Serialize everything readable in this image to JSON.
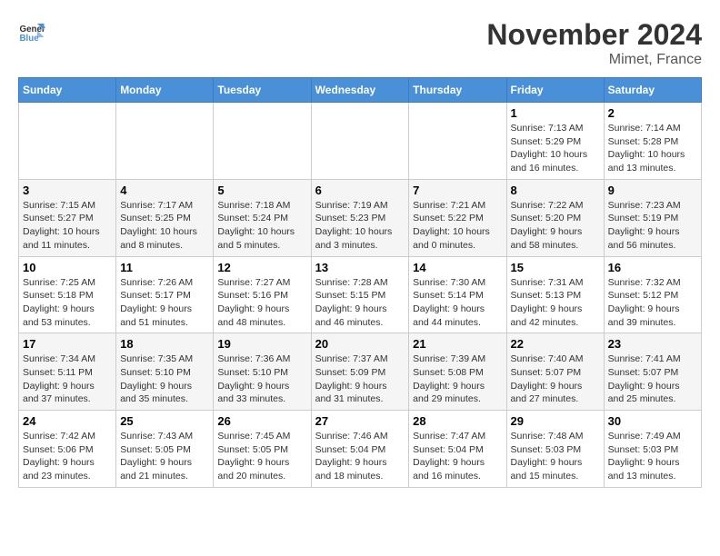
{
  "logo": {
    "line1": "General",
    "line2": "Blue"
  },
  "title": "November 2024",
  "location": "Mimet, France",
  "days_of_week": [
    "Sunday",
    "Monday",
    "Tuesday",
    "Wednesday",
    "Thursday",
    "Friday",
    "Saturday"
  ],
  "weeks": [
    [
      {
        "num": "",
        "info": ""
      },
      {
        "num": "",
        "info": ""
      },
      {
        "num": "",
        "info": ""
      },
      {
        "num": "",
        "info": ""
      },
      {
        "num": "",
        "info": ""
      },
      {
        "num": "1",
        "info": "Sunrise: 7:13 AM\nSunset: 5:29 PM\nDaylight: 10 hours and 16 minutes."
      },
      {
        "num": "2",
        "info": "Sunrise: 7:14 AM\nSunset: 5:28 PM\nDaylight: 10 hours and 13 minutes."
      }
    ],
    [
      {
        "num": "3",
        "info": "Sunrise: 7:15 AM\nSunset: 5:27 PM\nDaylight: 10 hours and 11 minutes."
      },
      {
        "num": "4",
        "info": "Sunrise: 7:17 AM\nSunset: 5:25 PM\nDaylight: 10 hours and 8 minutes."
      },
      {
        "num": "5",
        "info": "Sunrise: 7:18 AM\nSunset: 5:24 PM\nDaylight: 10 hours and 5 minutes."
      },
      {
        "num": "6",
        "info": "Sunrise: 7:19 AM\nSunset: 5:23 PM\nDaylight: 10 hours and 3 minutes."
      },
      {
        "num": "7",
        "info": "Sunrise: 7:21 AM\nSunset: 5:22 PM\nDaylight: 10 hours and 0 minutes."
      },
      {
        "num": "8",
        "info": "Sunrise: 7:22 AM\nSunset: 5:20 PM\nDaylight: 9 hours and 58 minutes."
      },
      {
        "num": "9",
        "info": "Sunrise: 7:23 AM\nSunset: 5:19 PM\nDaylight: 9 hours and 56 minutes."
      }
    ],
    [
      {
        "num": "10",
        "info": "Sunrise: 7:25 AM\nSunset: 5:18 PM\nDaylight: 9 hours and 53 minutes."
      },
      {
        "num": "11",
        "info": "Sunrise: 7:26 AM\nSunset: 5:17 PM\nDaylight: 9 hours and 51 minutes."
      },
      {
        "num": "12",
        "info": "Sunrise: 7:27 AM\nSunset: 5:16 PM\nDaylight: 9 hours and 48 minutes."
      },
      {
        "num": "13",
        "info": "Sunrise: 7:28 AM\nSunset: 5:15 PM\nDaylight: 9 hours and 46 minutes."
      },
      {
        "num": "14",
        "info": "Sunrise: 7:30 AM\nSunset: 5:14 PM\nDaylight: 9 hours and 44 minutes."
      },
      {
        "num": "15",
        "info": "Sunrise: 7:31 AM\nSunset: 5:13 PM\nDaylight: 9 hours and 42 minutes."
      },
      {
        "num": "16",
        "info": "Sunrise: 7:32 AM\nSunset: 5:12 PM\nDaylight: 9 hours and 39 minutes."
      }
    ],
    [
      {
        "num": "17",
        "info": "Sunrise: 7:34 AM\nSunset: 5:11 PM\nDaylight: 9 hours and 37 minutes."
      },
      {
        "num": "18",
        "info": "Sunrise: 7:35 AM\nSunset: 5:10 PM\nDaylight: 9 hours and 35 minutes."
      },
      {
        "num": "19",
        "info": "Sunrise: 7:36 AM\nSunset: 5:10 PM\nDaylight: 9 hours and 33 minutes."
      },
      {
        "num": "20",
        "info": "Sunrise: 7:37 AM\nSunset: 5:09 PM\nDaylight: 9 hours and 31 minutes."
      },
      {
        "num": "21",
        "info": "Sunrise: 7:39 AM\nSunset: 5:08 PM\nDaylight: 9 hours and 29 minutes."
      },
      {
        "num": "22",
        "info": "Sunrise: 7:40 AM\nSunset: 5:07 PM\nDaylight: 9 hours and 27 minutes."
      },
      {
        "num": "23",
        "info": "Sunrise: 7:41 AM\nSunset: 5:07 PM\nDaylight: 9 hours and 25 minutes."
      }
    ],
    [
      {
        "num": "24",
        "info": "Sunrise: 7:42 AM\nSunset: 5:06 PM\nDaylight: 9 hours and 23 minutes."
      },
      {
        "num": "25",
        "info": "Sunrise: 7:43 AM\nSunset: 5:05 PM\nDaylight: 9 hours and 21 minutes."
      },
      {
        "num": "26",
        "info": "Sunrise: 7:45 AM\nSunset: 5:05 PM\nDaylight: 9 hours and 20 minutes."
      },
      {
        "num": "27",
        "info": "Sunrise: 7:46 AM\nSunset: 5:04 PM\nDaylight: 9 hours and 18 minutes."
      },
      {
        "num": "28",
        "info": "Sunrise: 7:47 AM\nSunset: 5:04 PM\nDaylight: 9 hours and 16 minutes."
      },
      {
        "num": "29",
        "info": "Sunrise: 7:48 AM\nSunset: 5:03 PM\nDaylight: 9 hours and 15 minutes."
      },
      {
        "num": "30",
        "info": "Sunrise: 7:49 AM\nSunset: 5:03 PM\nDaylight: 9 hours and 13 minutes."
      }
    ]
  ]
}
